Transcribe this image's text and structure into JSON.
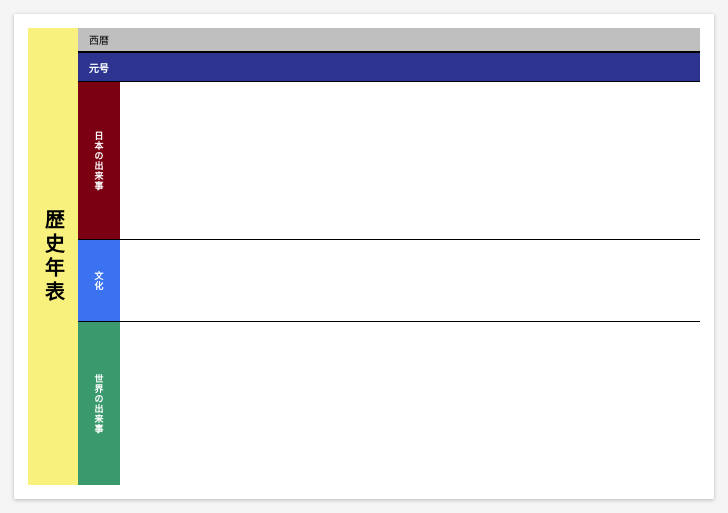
{
  "title": "歴史年表",
  "rows": {
    "seireki": {
      "label": "西暦"
    },
    "gengo": {
      "label": "元号"
    },
    "japan": {
      "label": "日本の出来事"
    },
    "culture": {
      "label": "文化"
    },
    "world": {
      "label": "世界の出来事"
    }
  }
}
